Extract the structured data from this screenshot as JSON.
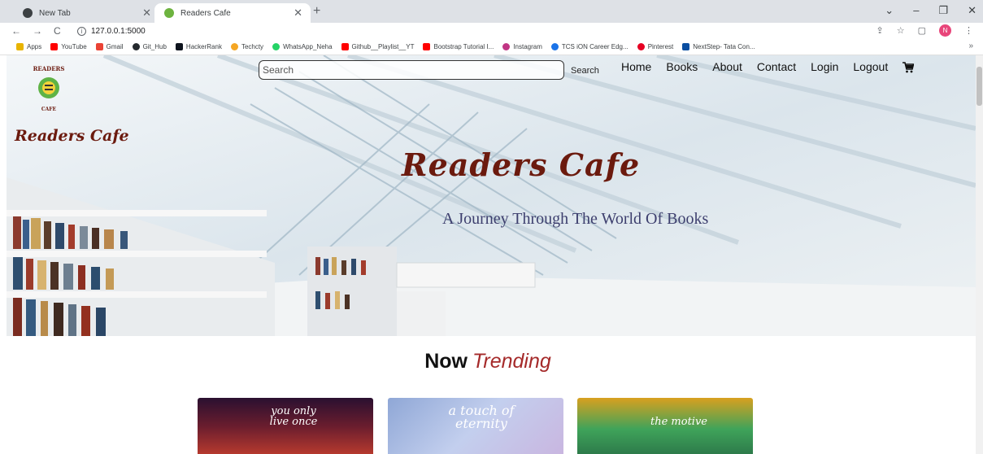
{
  "browser": {
    "tabs": [
      {
        "title": "New Tab"
      },
      {
        "title": "Readers Cafe"
      }
    ],
    "url": "127.0.0.1:5000",
    "profile_initial": "N",
    "bookmarks": [
      {
        "label": "Apps",
        "color": "#4285f4"
      },
      {
        "label": "YouTube",
        "color": "#ff0000"
      },
      {
        "label": "Gmail",
        "color": "#ea4335"
      },
      {
        "label": "Git_Hub",
        "color": "#24292e"
      },
      {
        "label": "HackerRank",
        "color": "#1ba94c"
      },
      {
        "label": "Techcty",
        "color": "#f5a623"
      },
      {
        "label": "WhatsApp_Neha",
        "color": "#25d366"
      },
      {
        "label": "Github__Playlist__YT",
        "color": "#ff0000"
      },
      {
        "label": "Bootstrap Tutorial I...",
        "color": "#ff0000"
      },
      {
        "label": "Instagram",
        "color": "#c13584"
      },
      {
        "label": "TCS iON Career Edg...",
        "color": "#1a73e8"
      },
      {
        "label": "Pinterest",
        "color": "#e60023"
      },
      {
        "label": "NextStep- Tata Con...",
        "color": "#0a4ea1"
      }
    ]
  },
  "site": {
    "logo_text_top": "READERS",
    "logo_text_bottom": "CAFE",
    "brand": "Readers Cafe",
    "search": {
      "placeholder": "Search",
      "button": "Search"
    },
    "nav": [
      "Home",
      "Books",
      "About",
      "Contact",
      "Login",
      "Logout"
    ],
    "hero": {
      "title": "Readers Cafe",
      "tagline": "A Journey Through The World Of Books"
    },
    "trending": {
      "prefix": "Now",
      "accent": "Trending"
    },
    "books": [
      {
        "cover_text": "you only live once",
        "colors": [
          "#2a1030",
          "#b83a2e"
        ]
      },
      {
        "cover_text": "a touch of eternity",
        "colors": [
          "#8fa7d6",
          "#c9b6e0"
        ]
      },
      {
        "cover_text": "the motive",
        "colors": [
          "#d9a01f",
          "#2d7a4a"
        ]
      }
    ]
  }
}
